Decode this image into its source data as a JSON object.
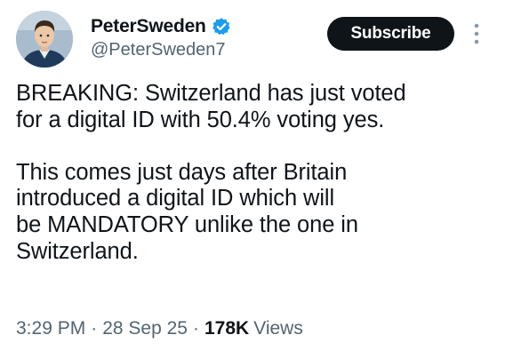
{
  "author": {
    "display_name": "PeterSweden",
    "handle": "@PeterSweden7",
    "verified_color": "#1d9bf0"
  },
  "actions": {
    "subscribe_label": "Subscribe",
    "more_icon": "more-vertical-icon"
  },
  "tweet": {
    "paragraph_1": [
      "BREAKING: Switzerland has just voted",
      "for a digital ID with 50.4% voting yes."
    ],
    "paragraph_2": [
      "This comes just days after Britain",
      "introduced a digital ID which will",
      "be MANDATORY unlike the one in",
      "Switzerland."
    ]
  },
  "meta": {
    "time": "3:29 PM",
    "separator": "·",
    "date": "28 Sep 25",
    "views_count": "178K",
    "views_label": "Views"
  },
  "colors": {
    "text_primary": "#0f1419",
    "text_secondary": "#536471",
    "button_bg": "#0f1419",
    "button_text": "#ffffff"
  }
}
